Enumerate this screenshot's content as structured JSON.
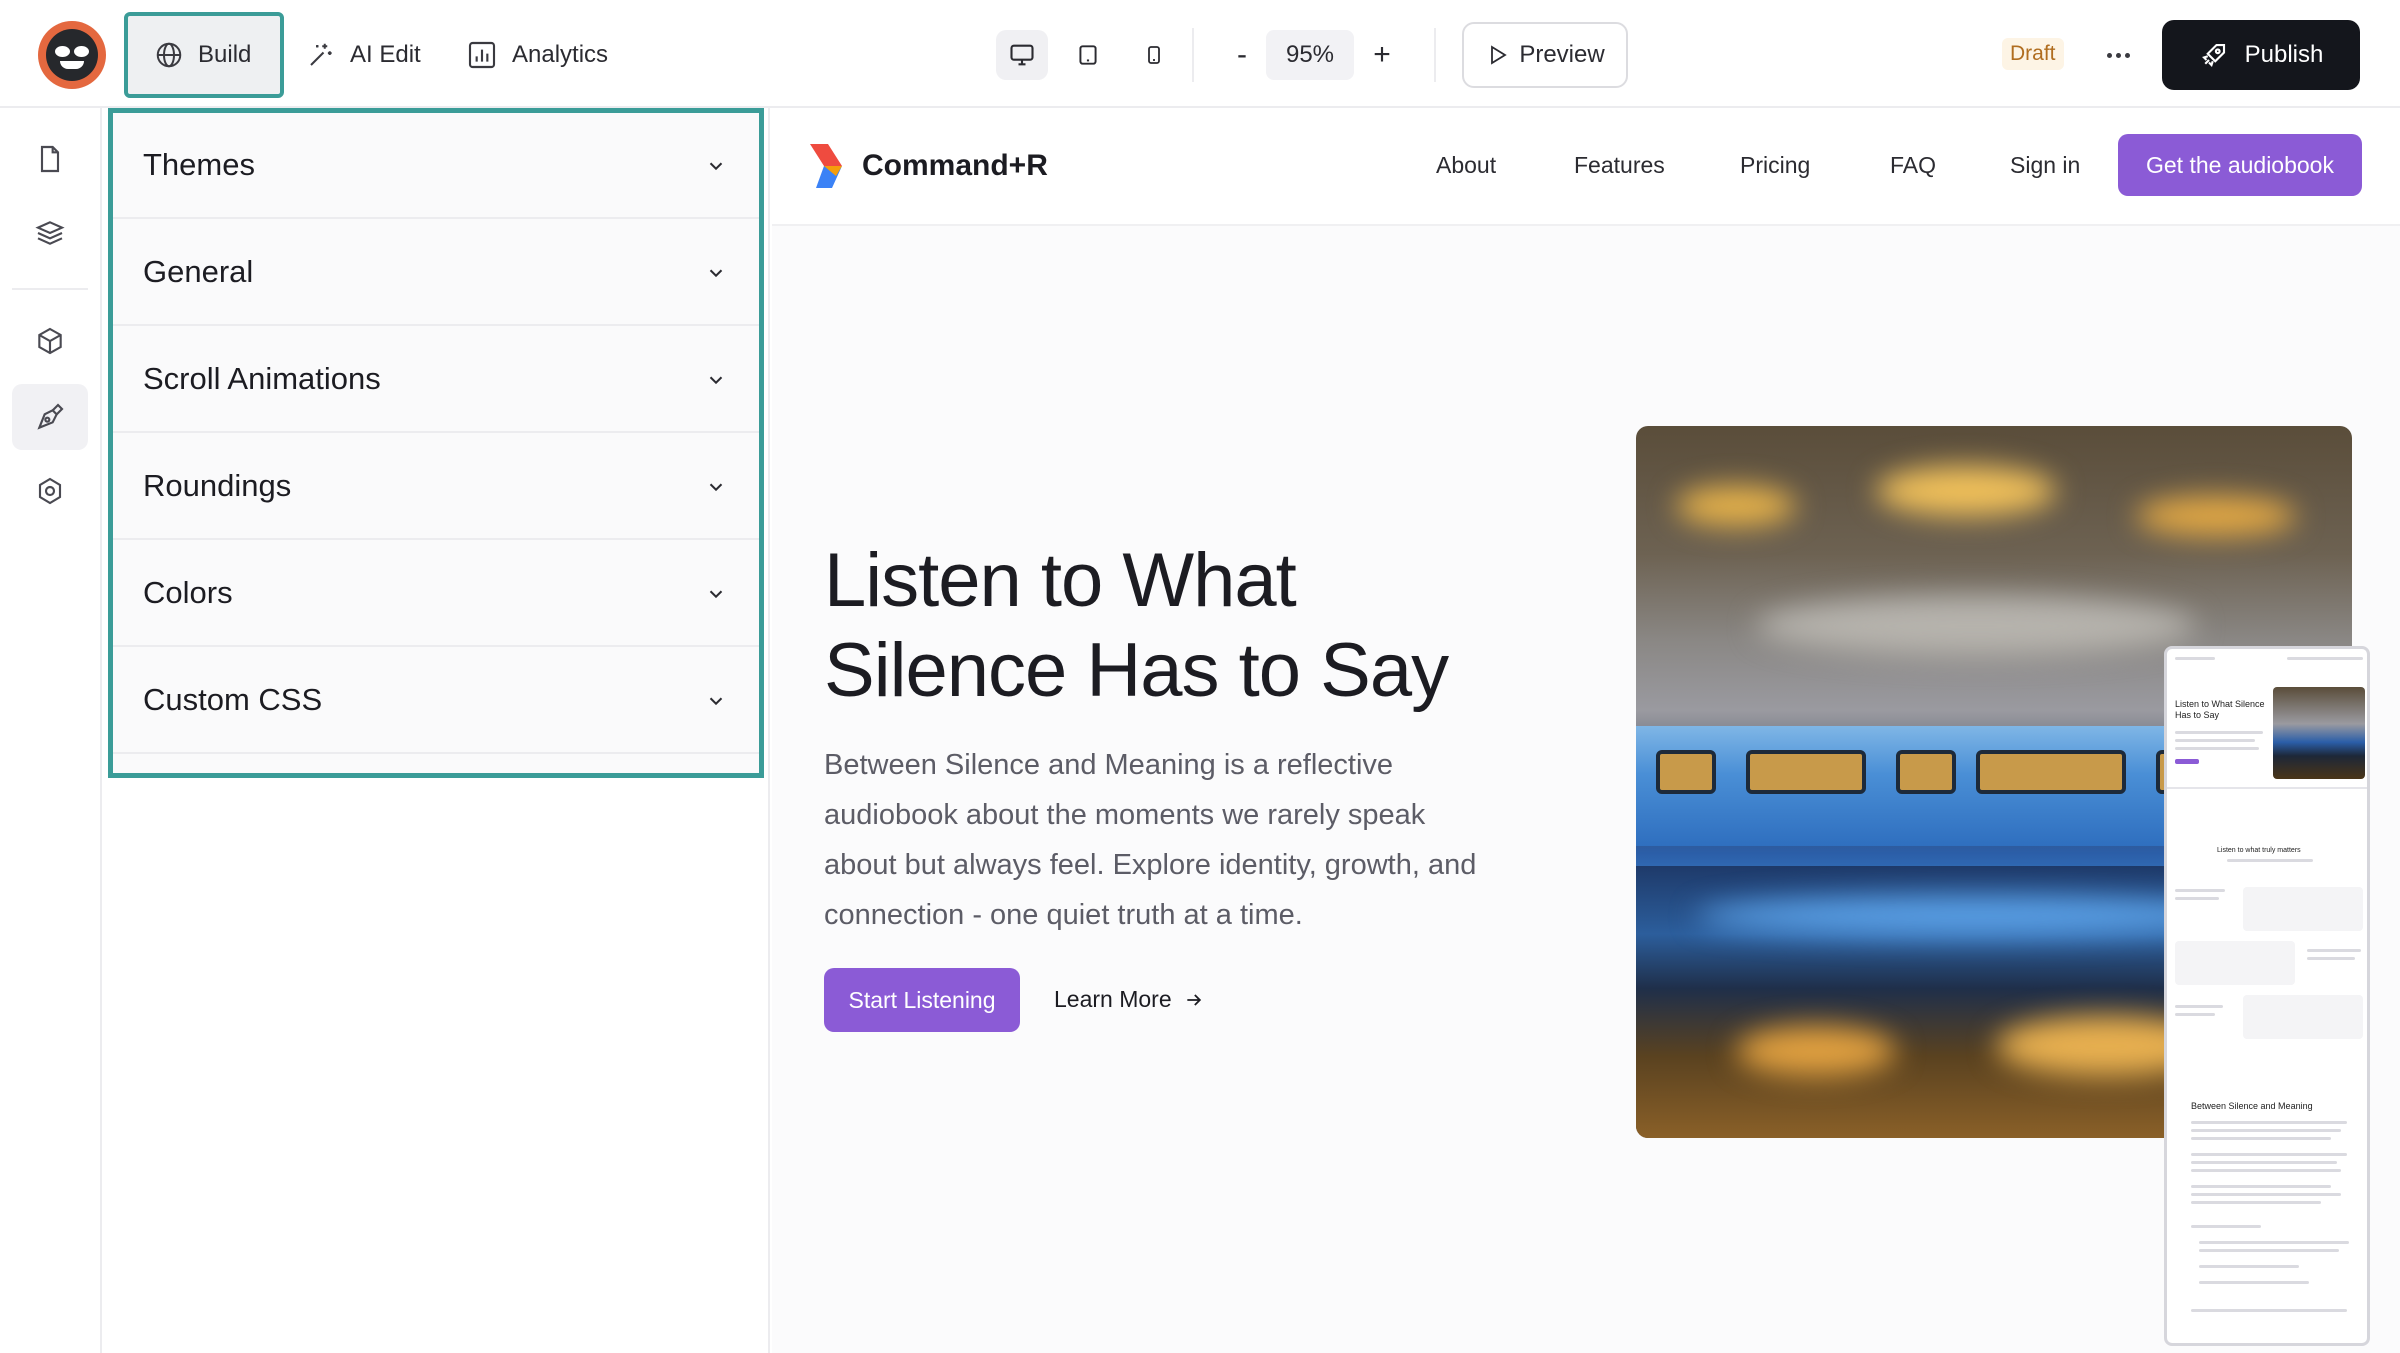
{
  "toolbar": {
    "build_label": "Build",
    "ai_edit_label": "AI Edit",
    "analytics_label": "Analytics",
    "zoom_minus": "-",
    "zoom_value": "95%",
    "zoom_plus": "+",
    "preview_label": "Preview",
    "status": "Draft",
    "publish_label": "Publish"
  },
  "panel": {
    "sections": [
      {
        "label": "Themes"
      },
      {
        "label": "General"
      },
      {
        "label": "Scroll Animations"
      },
      {
        "label": "Roundings"
      },
      {
        "label": "Colors"
      },
      {
        "label": "Custom CSS"
      }
    ]
  },
  "site": {
    "brand": "Command+R",
    "nav": [
      "About",
      "Features",
      "Pricing",
      "FAQ",
      "Sign in"
    ],
    "cta": "Get the audiobook",
    "hero_title": "Listen to What Silence Has to Say",
    "hero_desc": "Between Silence and Meaning is a reflective audiobook about the moments we rarely speak about but always feel. Explore identity, growth, and connection - one quiet truth at a time.",
    "start_btn": "Start Listening",
    "learn_more": "Learn More"
  },
  "mini_preview": {
    "hero_title": "Listen to What Silence Has to Say",
    "section_title": "Listen to what truly matters",
    "book_title": "Between Silence and Meaning"
  },
  "colors": {
    "accent": "#8b5bd6",
    "highlight": "#3b9c98",
    "publish_bg": "#14161c",
    "draft_text": "#b06d1f"
  }
}
